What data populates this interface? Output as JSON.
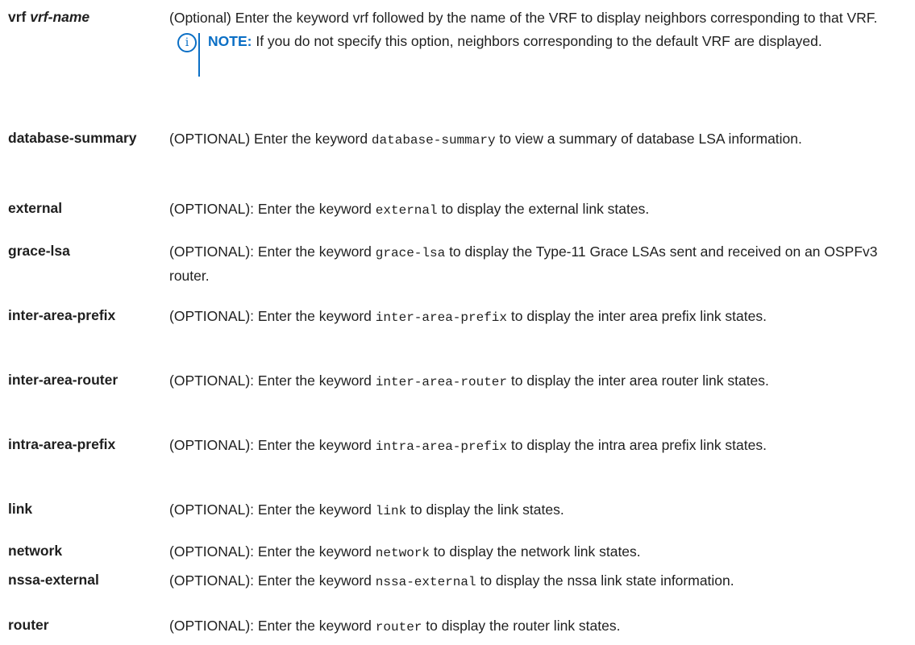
{
  "params": [
    {
      "term": "vrf",
      "term_arg": "vrf-name",
      "desc_plain": "(Optional) Enter the keyword vrf followed by the name of the VRF to display neighbors corresponding to that VRF.",
      "note_label": "NOTE:",
      "note_text": "If you do not specify this option, neighbors corresponding to the default VRF are displayed.",
      "note_icon": "info-icon"
    },
    {
      "term": "database-summary",
      "pre": "(OPTIONAL) Enter the keyword ",
      "keyword": "database-summary",
      "post": " to view a summary of database LSA information."
    },
    {
      "term": "external",
      "pre": "(OPTIONAL): Enter the keyword ",
      "keyword": "external",
      "post": " to display the external link states."
    },
    {
      "term": "grace-lsa",
      "pre": "(OPTIONAL): Enter the keyword ",
      "keyword": "grace-lsa",
      "post": " to display the Type-11 Grace LSAs sent and received on an OSPFv3 router."
    },
    {
      "term": "inter-area-prefix",
      "pre": "(OPTIONAL): Enter the keyword ",
      "keyword": "inter-area-prefix",
      "post": " to display the inter area prefix link states."
    },
    {
      "term": "inter-area-router",
      "pre": "(OPTIONAL): Enter the keyword ",
      "keyword": "inter-area-router",
      "post": " to display the inter area router link states."
    },
    {
      "term": "intra-area-prefix",
      "pre": "(OPTIONAL): Enter the keyword ",
      "keyword": "intra-area-prefix",
      "post": " to display the intra area prefix link states."
    },
    {
      "term": "link",
      "pre": "(OPTIONAL): Enter the keyword ",
      "keyword": "link",
      "post": " to display the link states."
    },
    {
      "term": "network",
      "pre": "(OPTIONAL): Enter the keyword ",
      "keyword": "network",
      "post": " to display the network link states."
    },
    {
      "term": "nssa-external",
      "pre": "(OPTIONAL): Enter the keyword ",
      "keyword": "nssa-external",
      "post": " to display the nssa link state information."
    },
    {
      "term": "router",
      "pre": "(OPTIONAL): Enter the keyword ",
      "keyword": "router",
      "post": " to display the router link states."
    }
  ],
  "colors": {
    "note_accent": "#0b6fc5",
    "text": "#1f1f1f"
  }
}
